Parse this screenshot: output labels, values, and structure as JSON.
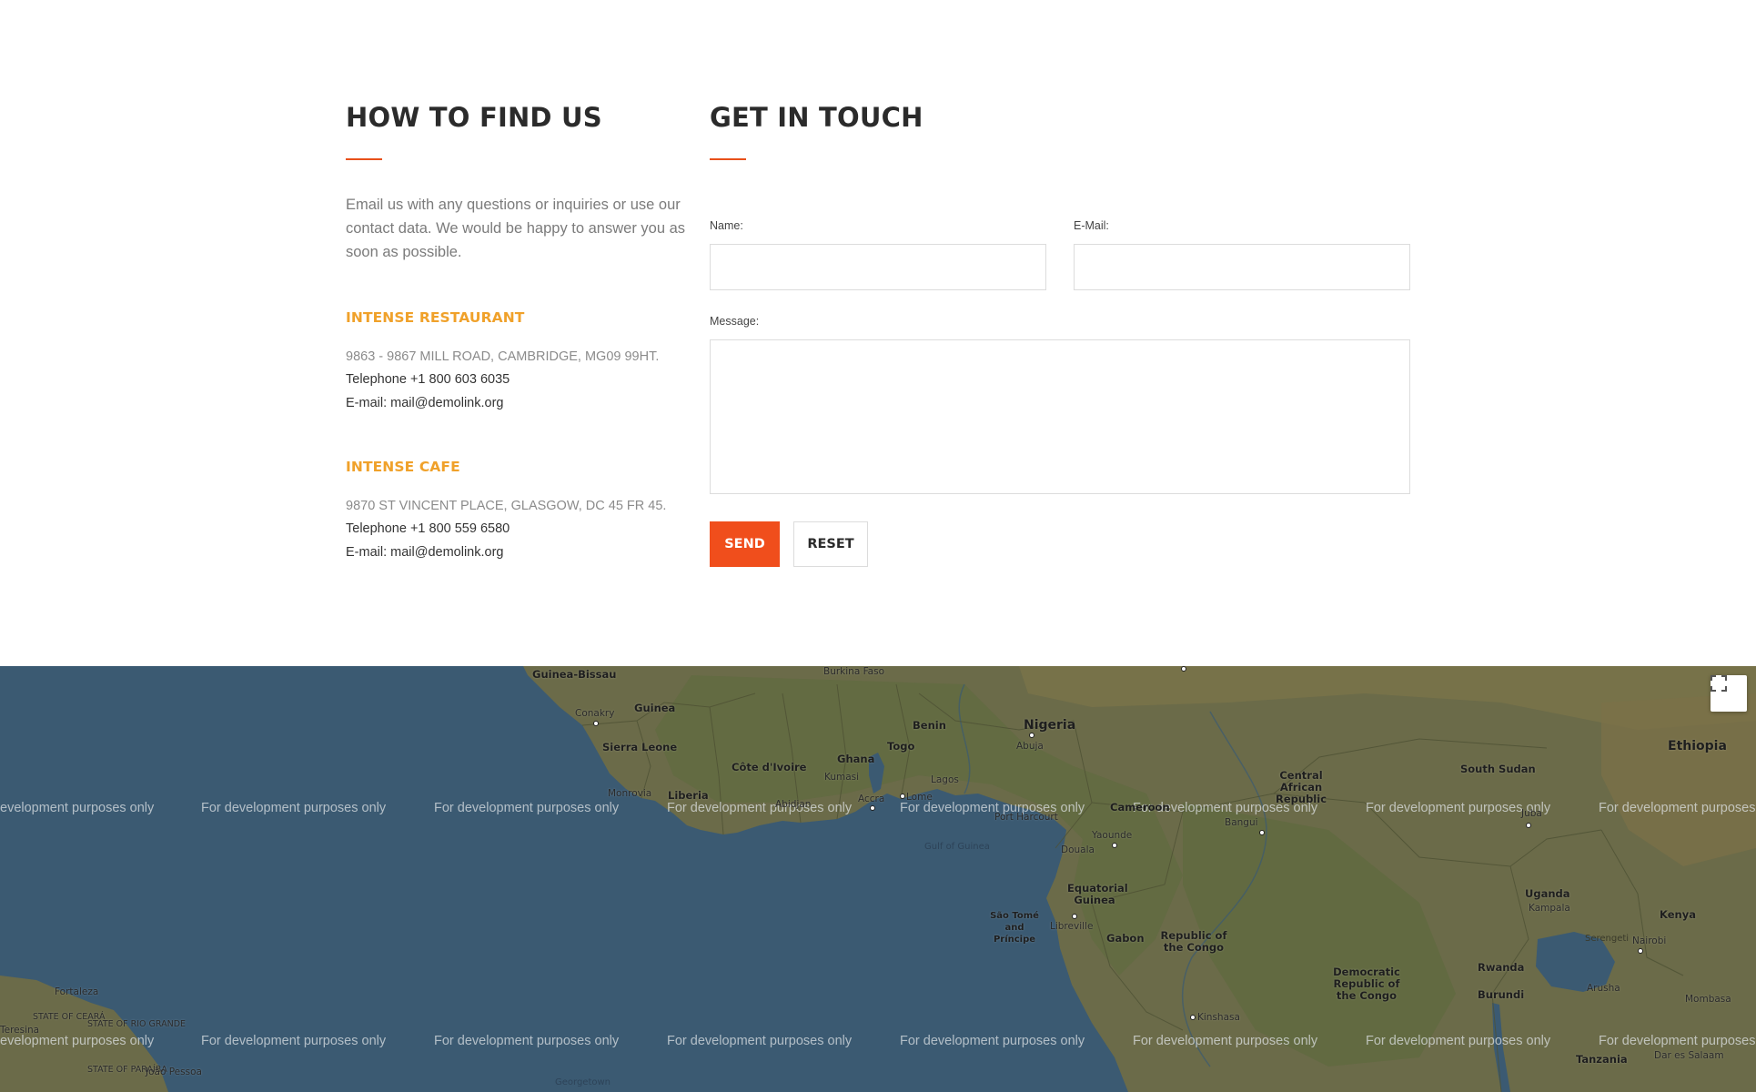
{
  "find_us": {
    "title": "HOW TO FIND US",
    "intro": "Email us with any questions or inquiries or use our contact data. We would be happy to answer you as soon as possible.",
    "places": [
      {
        "name": "INTENSE RESTAURANT",
        "address": "9863 - 9867 MILL ROAD, CAMBRIDGE, MG09 99HT.",
        "telephone": "Telephone +1 800 603 6035",
        "email": "E-mail: mail@demolink.org"
      },
      {
        "name": "INTENSE CAFE",
        "address": "9870 ST VINCENT PLACE, GLASGOW, DC 45 FR 45.",
        "telephone": "Telephone +1 800 559 6580",
        "email": "E-mail: mail@demolink.org"
      }
    ]
  },
  "contact_form": {
    "title": "GET IN TOUCH",
    "name_label": "Name:",
    "email_label": "E-Mail:",
    "message_label": "Message:",
    "name_value": "",
    "email_value": "",
    "message_value": "",
    "send_label": "SEND",
    "reset_label": "RESET"
  },
  "colors": {
    "accent": "#f04e1c",
    "place_name": "#f0a12a",
    "ocean": "#3b5a72"
  },
  "map": {
    "watermark": "For development purposes only",
    "watermark_cut": "evelopment purposes only",
    "watermark_cut_right": "For development purposes",
    "fullscreen_icon": "fullscreen-icon",
    "labels": {
      "guinea_bissau": "Guinea-Bissau",
      "burkina_faso": "Burkina Faso",
      "conakry": "Conakry",
      "guinea": "Guinea",
      "sierra_leone": "Sierra Leone",
      "benin": "Benin",
      "nigeria": "Nigeria",
      "abuja": "Abuja",
      "togo": "Togo",
      "ghana": "Ghana",
      "cote_divoire": "Côte d'Ivoire",
      "kumasi": "Kumasi",
      "lagos": "Lagos",
      "monrovia": "Monrovia",
      "liberia": "Liberia",
      "abidjan": "Abidjan",
      "accra": "Accra",
      "lome": "Lome",
      "port_harcourt": "Port Harcourt",
      "cameroon": "Cameroon",
      "yaounde": "Yaounde",
      "douala": "Douala",
      "gulf_of_guinea": "Gulf of Guinea",
      "central_african_republic": "Central African Republic",
      "bangui": "Bangui",
      "south_sudan": "South Sudan",
      "juba": "Juba",
      "ethiopia": "Ethiopia",
      "equatorial_guinea": "Equatorial Guinea",
      "sao_tome": "São Tomé and Príncipe",
      "libreville": "Libreville",
      "gabon": "Gabon",
      "republic_of_the_congo": "Republic of the Congo",
      "uganda": "Uganda",
      "kampala": "Kampala",
      "kenya": "Kenya",
      "nairobi": "Nairobi",
      "rwanda": "Rwanda",
      "burundi": "Burundi",
      "drc": "Democratic Republic of the Congo",
      "kinshasa": "Kinshasa",
      "arusha": "Arusha",
      "mombasa": "Mombasa",
      "tanzania": "Tanzania",
      "dar_es_salaam": "Dar es Salaam",
      "fortaleza": "Fortaleza",
      "state_of_ceara": "STATE OF CEARÁ",
      "state_of_rio_grande": "STATE OF RIO GRANDE",
      "state_of_paraiba": "STATE OF PARAÍBA",
      "joao_pessoa": "João Pessoa",
      "teresina": "Teresina",
      "georgetown": "Georgetown",
      "serengeti": "Serengeti"
    }
  }
}
